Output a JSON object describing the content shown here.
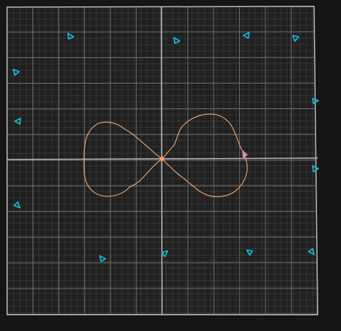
{
  "canvas": {
    "background": "#151515",
    "plot_background": "#202020",
    "minor_grid_color": "#3a3a3a",
    "major_grid_color": "#6f6f6f",
    "axis_color": "#bdbdbd",
    "border_color": "#bdbdbd",
    "curve_color": "#f0a06a",
    "marker_color": "#17b6d6",
    "cursor_color": "#d86b74",
    "center_color": "#f0a06a"
  },
  "icons": {
    "marker": "triangle-marker-icon",
    "cursor": "cursor-marker-icon",
    "center": "origin-point-icon"
  }
}
